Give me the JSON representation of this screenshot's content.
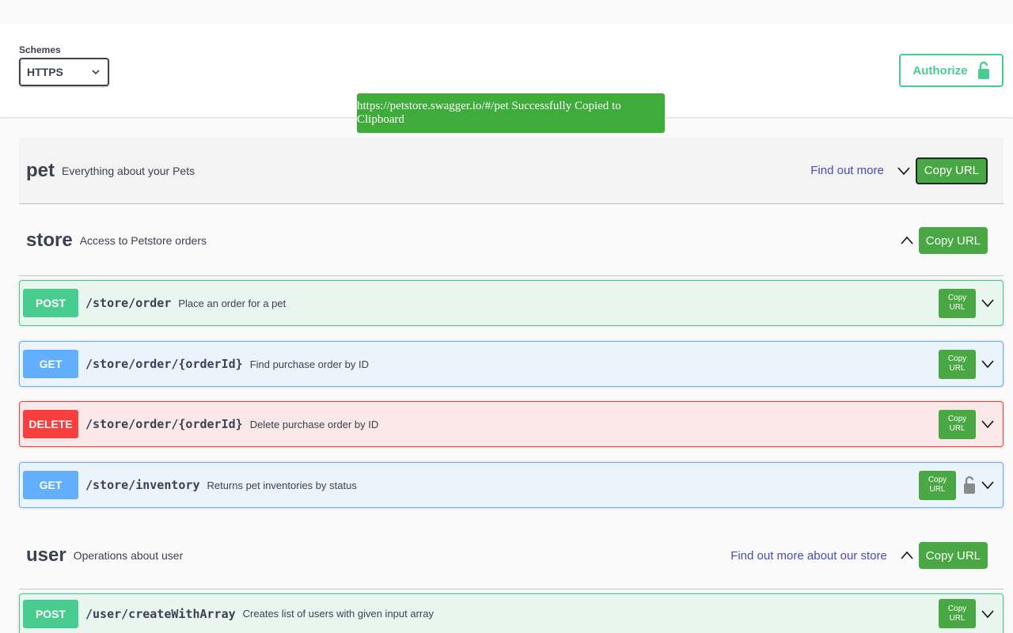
{
  "schemes": {
    "label": "Schemes",
    "selected": "HTTPS"
  },
  "authorize": {
    "label": "Authorize"
  },
  "toast": {
    "message": "https://petstore.swagger.io/#/pet Successfully Copied to Clipboard"
  },
  "colors": {
    "post": "#49cc90",
    "get": "#61affe",
    "delete": "#f93e3e",
    "copy_button": "#49a843",
    "toast": "#3eab3a",
    "link": "#4a4ab6"
  },
  "tags": [
    {
      "name": "pet",
      "description": "Everything about your Pets",
      "link": "Find out more",
      "copy_label": "Copy URL",
      "state": "collapsed"
    },
    {
      "name": "store",
      "description": "Access to Petstore orders",
      "copy_label": "Copy URL",
      "state": "expanded"
    },
    {
      "name": "user",
      "description": "Operations about user",
      "link": "Find out more about our store",
      "copy_label": "Copy URL",
      "state": "expanded"
    }
  ],
  "operations": [
    {
      "method": "POST",
      "path": "/store/order",
      "summary": "Place an order for a pet",
      "copy_label_1": "Copy",
      "copy_label_2": "URL"
    },
    {
      "method": "GET",
      "path": "/store/order/{orderId}",
      "summary": "Find purchase order by ID",
      "copy_label_1": "Copy",
      "copy_label_2": "URL"
    },
    {
      "method": "DELETE",
      "path": "/store/order/{orderId}",
      "summary": "Delete purchase order by ID",
      "copy_label_1": "Copy",
      "copy_label_2": "URL"
    },
    {
      "method": "GET",
      "path": "/store/inventory",
      "summary": "Returns pet inventories by status",
      "copy_label_1": "Copy",
      "copy_label_2": "URL",
      "locked": true
    },
    {
      "method": "POST",
      "path": "/user/createWithArray",
      "summary": "Creates list of users with given input array",
      "copy_label_1": "Copy",
      "copy_label_2": "URL"
    }
  ]
}
